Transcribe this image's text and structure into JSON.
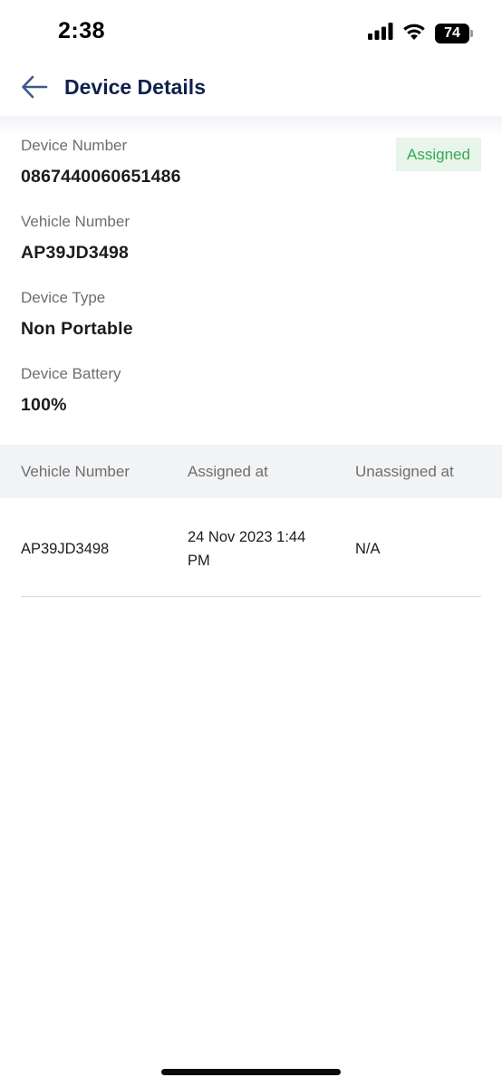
{
  "status_bar": {
    "time": "2:38",
    "battery": "74",
    "icons": [
      "cellular-signal-icon",
      "wifi-icon",
      "battery-icon"
    ]
  },
  "header": {
    "title": "Device Details",
    "back_icon": "arrow-left-icon"
  },
  "device": {
    "status": "Assigned",
    "fields": [
      {
        "label": "Device Number",
        "value": "0867440060651486"
      },
      {
        "label": "Vehicle Number",
        "value": "AP39JD3498"
      },
      {
        "label": "Device Type",
        "value": "Non Portable"
      },
      {
        "label": "Device Battery",
        "value": "100%"
      }
    ]
  },
  "history": {
    "columns": [
      "Vehicle Number",
      "Assigned at",
      "Unassigned at"
    ],
    "rows": [
      [
        "AP39JD3498",
        "24 Nov 2023 1:44 PM",
        "N/A"
      ]
    ]
  },
  "colors": {
    "title": "#10224a",
    "back_arrow": "#3b5a8c",
    "badge_bg": "#e7f5ea",
    "badge_text": "#35a853",
    "label": "#6e6e6e"
  }
}
